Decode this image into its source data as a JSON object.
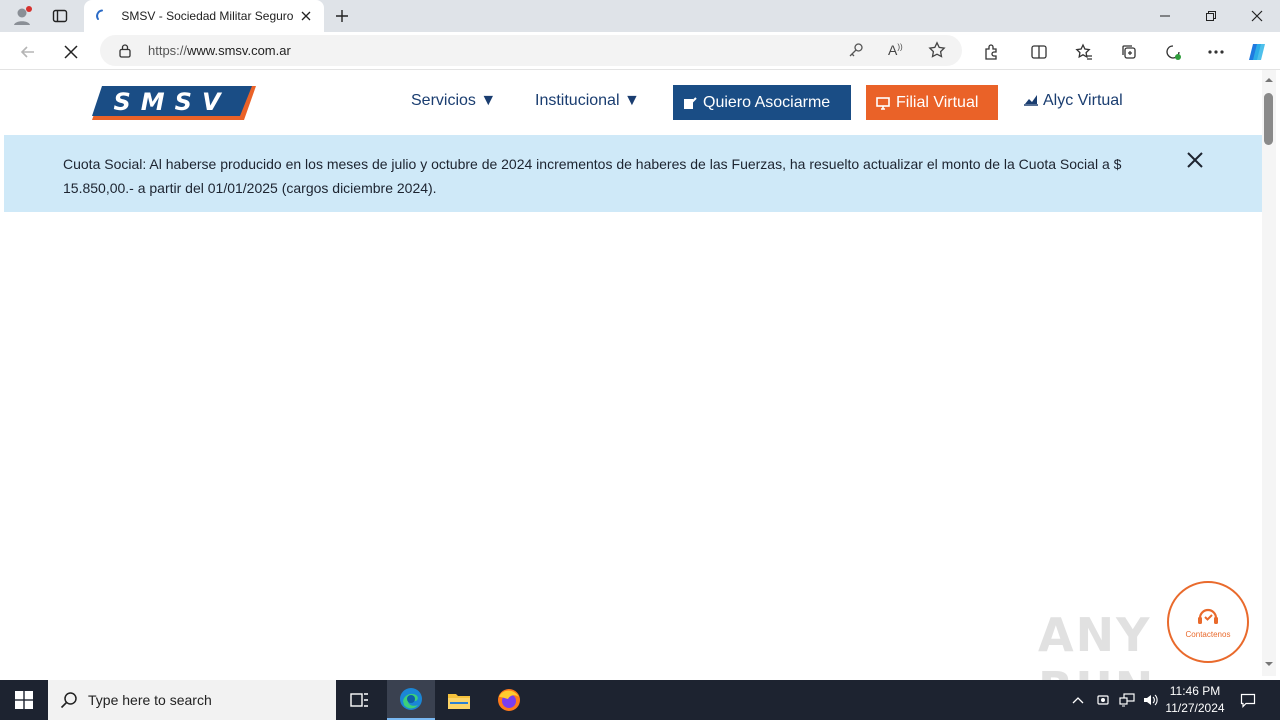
{
  "browser": {
    "tab_title": "SMSV - Sociedad Militar Seguro de Vida",
    "url_prefix": "https://",
    "url_host": "www.smsv.com.ar"
  },
  "site": {
    "logo_text": "SMSV",
    "nav": {
      "servicios": "Servicios ▼",
      "institucional": "Institucional ▼",
      "quiero_asociarme": "Quiero Asociarme",
      "filial_virtual": "Filial Virtual",
      "alyc_virtual": "Alyc Virtual"
    },
    "banner_message": "Cuota Social: Al haberse producido en los meses de julio y octubre de 2024 incrementos de haberes de las Fuerzas, ha resuelto actualizar el monto de la Cuota Social a $ 15.850,00.- a partir del 01/01/2025 (cargos diciembre 2024).",
    "contact_label": "Contactenos",
    "watermark": "ANY RUN"
  },
  "taskbar": {
    "search_placeholder": "Type here to search",
    "time": "11:46 PM",
    "date": "11/27/2024"
  },
  "colors": {
    "brand_blue": "#1a4d85",
    "brand_orange": "#ea6228",
    "banner_bg": "#cfe9f8"
  }
}
